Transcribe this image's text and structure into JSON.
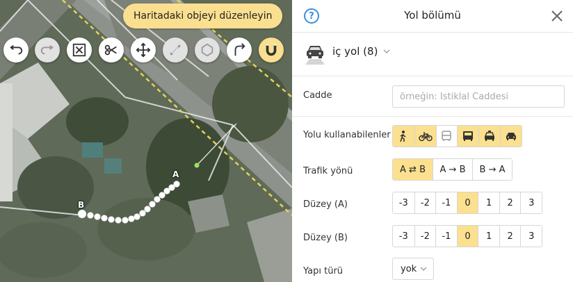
{
  "map": {
    "hint": "Haritadaki objeyi düzenleyin",
    "point_a_label": "A",
    "point_b_label": "B",
    "tools": [
      {
        "name": "undo-button",
        "icon": "undo-icon",
        "state": "normal"
      },
      {
        "name": "redo-button",
        "icon": "redo-icon",
        "state": "disabled"
      },
      {
        "name": "delete-geometry-button",
        "icon": "delete-box-icon",
        "state": "normal"
      },
      {
        "name": "cut-button",
        "icon": "scissors-icon",
        "state": "normal"
      },
      {
        "name": "move-button",
        "icon": "move-icon",
        "state": "normal"
      },
      {
        "name": "draw-line-button",
        "icon": "dotted-line-icon",
        "state": "disabled"
      },
      {
        "name": "polygon-button",
        "icon": "polygon-icon",
        "state": "disabled"
      },
      {
        "name": "branch-button",
        "icon": "branch-icon",
        "state": "normal"
      },
      {
        "name": "snap-button",
        "icon": "magnet-icon",
        "state": "active"
      }
    ]
  },
  "panel": {
    "help": "?",
    "title": "Yol bölümü",
    "category": {
      "value": "iç yol (8)",
      "icon": "car-icon"
    },
    "street": {
      "label": "Cadde",
      "placeholder": "örneğin: İstiklal Caddesi",
      "value": ""
    },
    "users": {
      "label": "Yolu kullanabilenler",
      "options": [
        {
          "icon": "pedestrian-icon",
          "on": true
        },
        {
          "icon": "bicycle-icon",
          "on": true
        },
        {
          "icon": "bus-icon",
          "on": false
        },
        {
          "icon": "truck-icon",
          "on": true
        },
        {
          "icon": "taxi-icon",
          "on": true
        },
        {
          "icon": "car-icon",
          "on": true
        }
      ]
    },
    "direction": {
      "label": "Trafik yönü",
      "options": [
        {
          "text": "A ⇄ B",
          "on": true
        },
        {
          "text": "A → B",
          "on": false
        },
        {
          "text": "B → A",
          "on": false
        }
      ]
    },
    "level_a": {
      "label": "Düzey (A)",
      "options": [
        "-3",
        "-2",
        "-1",
        "0",
        "1",
        "2",
        "3"
      ],
      "selected": "0"
    },
    "level_b": {
      "label": "Düzey (B)",
      "options": [
        "-3",
        "-2",
        "-1",
        "0",
        "1",
        "2",
        "3"
      ],
      "selected": "0"
    },
    "structure": {
      "label": "Yapı türü",
      "value": "yok"
    }
  },
  "colors": {
    "accent": "#fbe08f",
    "help": "#3a8fe0"
  }
}
